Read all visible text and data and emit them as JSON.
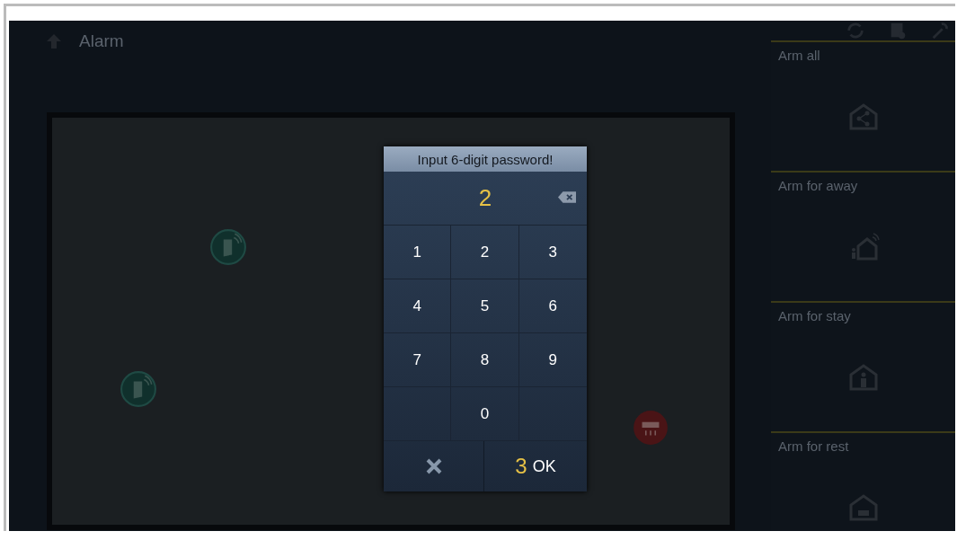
{
  "header": {
    "title": "Alarm"
  },
  "arm_modes": [
    {
      "label": "Arm all",
      "kind": "all"
    },
    {
      "label": "Arm for away",
      "kind": "away"
    },
    {
      "label": "Arm for stay",
      "kind": "stay"
    },
    {
      "label": "Arm for rest",
      "kind": "rest"
    }
  ],
  "password_dialog": {
    "title": "Input 6-digit password!",
    "entered": "2",
    "keys": [
      {
        "kind": "digit",
        "label": "1"
      },
      {
        "kind": "digit",
        "label": "2"
      },
      {
        "kind": "digit",
        "label": "3"
      },
      {
        "kind": "digit",
        "label": "4"
      },
      {
        "kind": "digit",
        "label": "5"
      },
      {
        "kind": "digit",
        "label": "6"
      },
      {
        "kind": "digit",
        "label": "7"
      },
      {
        "kind": "digit",
        "label": "8"
      },
      {
        "kind": "digit",
        "label": "9"
      },
      {
        "kind": "blank"
      },
      {
        "kind": "digit",
        "label": "0"
      },
      {
        "kind": "blank"
      }
    ],
    "countdown": "3",
    "ok_label": "OK"
  }
}
